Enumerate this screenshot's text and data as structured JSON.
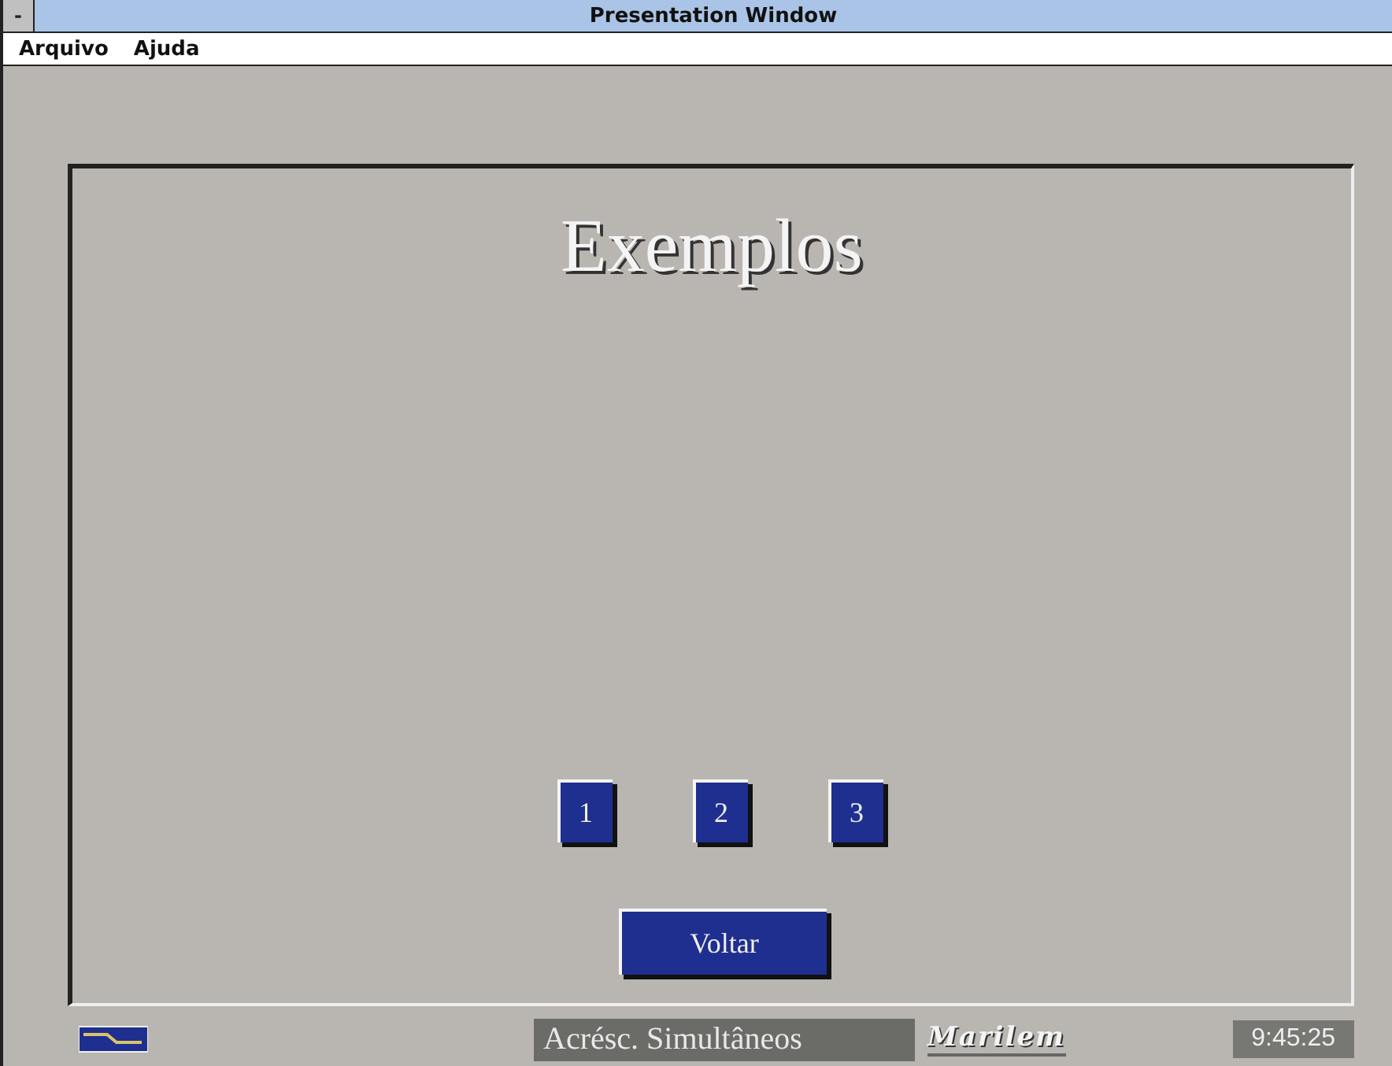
{
  "window": {
    "title": "Presentation Window",
    "control_menu": "-"
  },
  "menu": [
    "Arquivo",
    "Ajuda"
  ],
  "slide": {
    "title": "Exemplos",
    "example_buttons": [
      "1",
      "2",
      "3"
    ],
    "back_button": "Voltar"
  },
  "status_bar": {
    "section": "Acrésc. Simultâneos",
    "logo": "Marilem",
    "clock": "9:45:25"
  }
}
